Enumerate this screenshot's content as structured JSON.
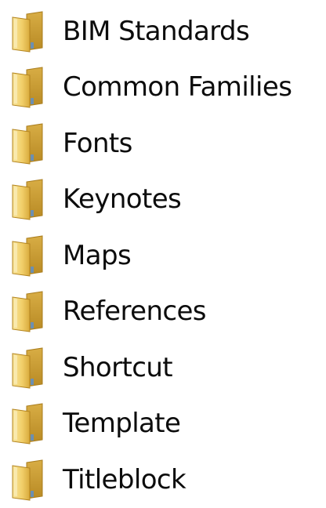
{
  "folders": [
    {
      "label": "BIM Standards",
      "icon": "folder-icon"
    },
    {
      "label": "Common Families",
      "icon": "folder-icon"
    },
    {
      "label": "Fonts",
      "icon": "folder-icon"
    },
    {
      "label": "Keynotes",
      "icon": "folder-icon"
    },
    {
      "label": "Maps",
      "icon": "folder-icon"
    },
    {
      "label": "References",
      "icon": "folder-icon"
    },
    {
      "label": "Shortcut",
      "icon": "folder-icon"
    },
    {
      "label": "Template",
      "icon": "folder-icon"
    },
    {
      "label": "Titleblock",
      "icon": "folder-icon"
    }
  ],
  "colors": {
    "folder_back": "#c99c2e",
    "folder_front": "#f4d77a",
    "folder_edge": "#b3841f",
    "text": "#0c0c0c"
  }
}
